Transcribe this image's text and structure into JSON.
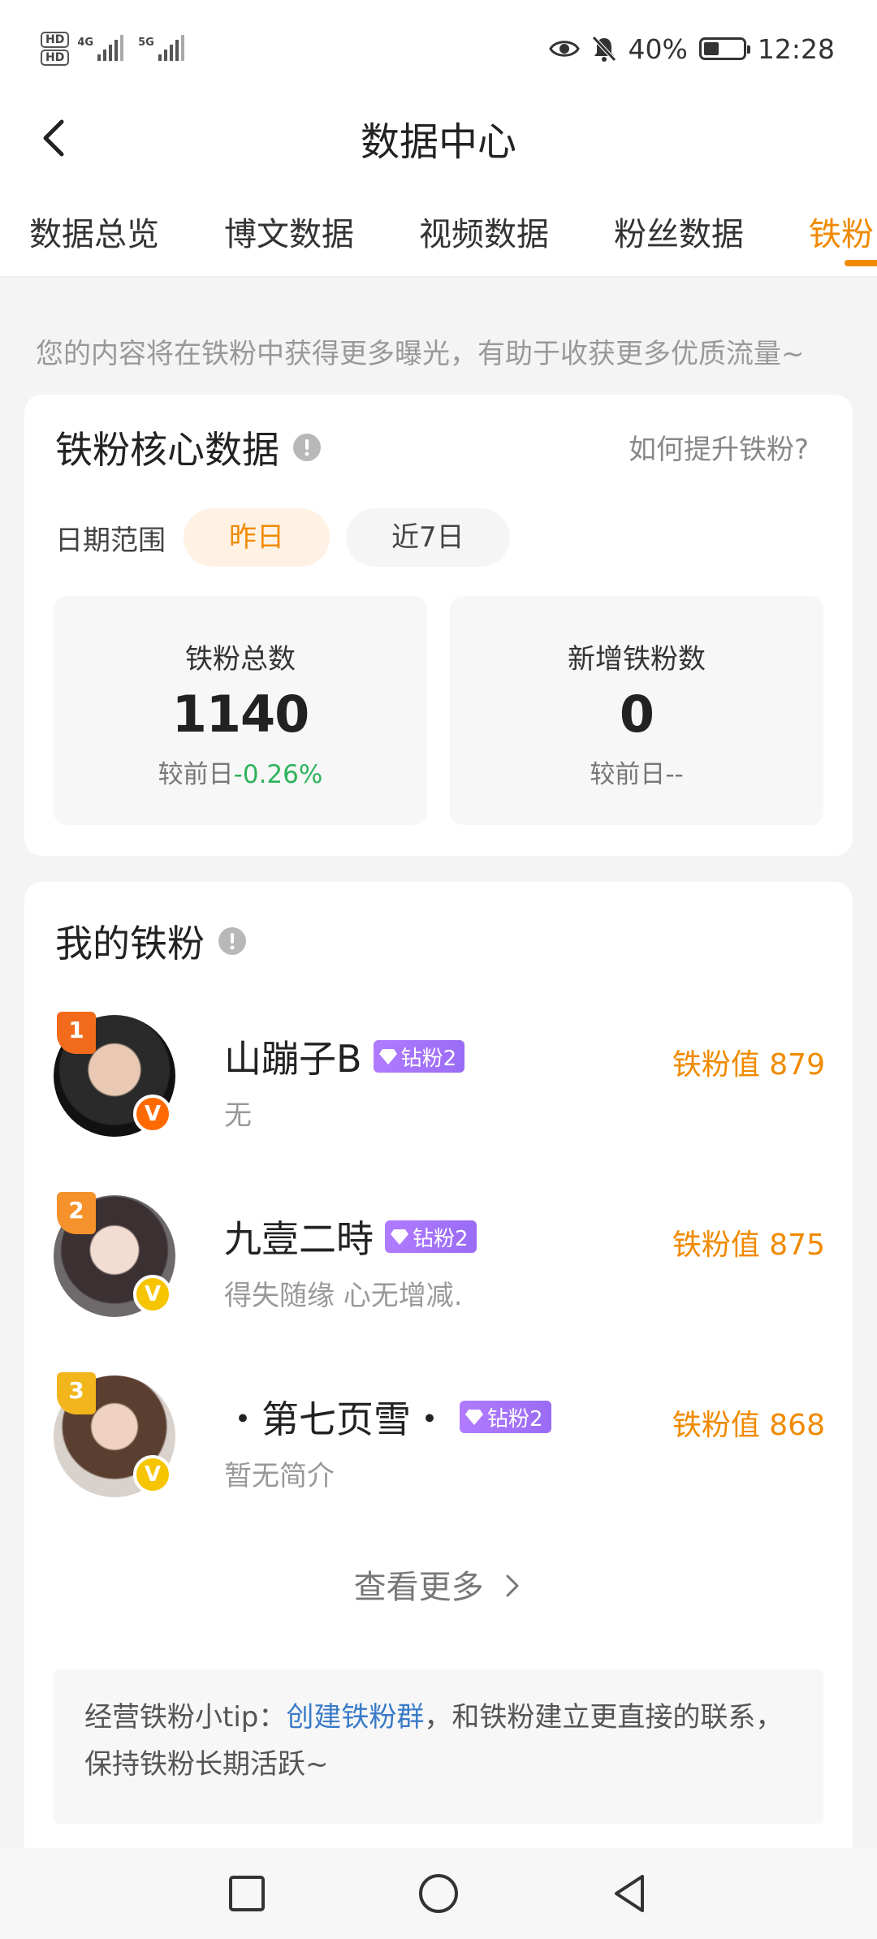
{
  "status_bar": {
    "hd_top": "HD",
    "hd_bottom": "HD",
    "net1": "4G",
    "net2": "5G",
    "battery": "40%",
    "time": "12:28"
  },
  "header": {
    "title": "数据中心"
  },
  "tabs": [
    {
      "label": "数据总览"
    },
    {
      "label": "博文数据"
    },
    {
      "label": "视频数据"
    },
    {
      "label": "粉丝数据"
    },
    {
      "label": "铁粉",
      "active": true
    }
  ],
  "hint": "您的内容将在铁粉中获得更多曝光，有助于收获更多优质流量~",
  "core": {
    "title": "铁粉核心数据",
    "how_link": "如何提升铁粉?",
    "date_label": "日期范围",
    "date_options": [
      "昨日",
      "近7日"
    ],
    "stats": [
      {
        "label": "铁粉总数",
        "value": "1140",
        "compare_prefix": "较前日",
        "compare_value": "-0.26%"
      },
      {
        "label": "新增铁粉数",
        "value": "0",
        "compare_prefix": "较前日",
        "compare_value": "--"
      }
    ]
  },
  "fans": {
    "title": "我的铁粉",
    "tier_label": "钻粉2",
    "score_prefix": "铁粉值",
    "items": [
      {
        "rank": "1",
        "name": "山蹦子B",
        "desc": "无",
        "score": "879",
        "verify": "V"
      },
      {
        "rank": "2",
        "name": "九壹二時",
        "desc": "得失随缘 心无增减.",
        "score": "875",
        "verify": "V"
      },
      {
        "rank": "3",
        "name": "・第七页雪・",
        "desc": "暂无简介",
        "score": "868",
        "verify": "V"
      }
    ],
    "see_more": "查看更多"
  },
  "tip": {
    "prefix": "经营铁粉小tip：",
    "link": "创建铁粉群",
    "suffix": "，和铁粉建立更直接的联系，保持铁粉长期活跃~"
  },
  "colors": {
    "accent": "#f08a00",
    "green": "#2fb35c",
    "link": "#3a7bc8",
    "tier": "#a374fa"
  }
}
